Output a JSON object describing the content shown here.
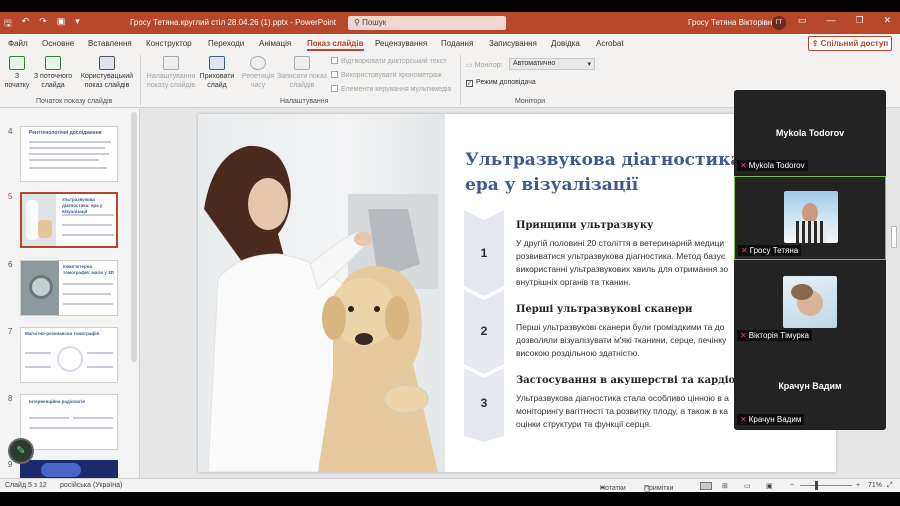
{
  "titlebar": {
    "doc_title": "Гросу Тетяна.круглий стіл 28.04.26 (1).pptx  -  PowerPoint",
    "search_placeholder": "Пошук",
    "user_name": "Гросу Тетяна Вікторівна",
    "user_initials": "ГТ",
    "minimize": "—",
    "restore": "❐",
    "close": "✕"
  },
  "menu": {
    "tabs": [
      "Файл",
      "Основне",
      "Вставлення",
      "Конструктор",
      "Переходи",
      "Анімація",
      "Показ слайдів",
      "Рецензування",
      "Подання",
      "Записування",
      "Довідка",
      "Acrobat"
    ],
    "active_tab": "Показ слайдів",
    "share_label": "Спільний доступ"
  },
  "ribbon": {
    "from_start": "З початку",
    "from_current": "З поточного слайда",
    "custom_show": "Користувацький показ слайдів",
    "group_start": "Початок показу слайдів",
    "setup_show": "Налаштування показу слайдів",
    "hide_slide": "Приховати слайд",
    "rehearse": "Репетиція часу",
    "record": "Записати показ слайдів",
    "chk_narration": "Відтворювати дикторський текст",
    "chk_timings": "Використовувати хронометраж",
    "chk_media": "Елементи керування мультимедіа",
    "group_setup": "Налаштування",
    "monitor_label": "Монітор:",
    "monitor_value": "Автоматично",
    "chk_presenter": "Режим доповідача",
    "group_monitors": "Монітори"
  },
  "thumbnails": [
    {
      "num": "4",
      "title": "Рентгенологічні дослідження"
    },
    {
      "num": "5",
      "title": "Ультразвукова діагностика: ера у візуалізації"
    },
    {
      "num": "6",
      "title": "Комп'ютерна томографія: магія у 3D"
    },
    {
      "num": "7",
      "title": "Магнітно-резонансна томографія"
    },
    {
      "num": "8",
      "title": "Інтервенційна радіологія"
    },
    {
      "num": "9",
      "title": ""
    }
  ],
  "slide": {
    "title": "Ультразвукова діагностика: ера у візуалізації",
    "steps": [
      {
        "num": "1",
        "title": "Принципи ультразвуку",
        "lines": [
          "У другій половині 20 століття в ветеринарній медици",
          "розвиватися ультразвукова діагностика. Метод базує",
          "використанні ультразвукових хвиль для отримання зо",
          "внутрішніх органів та тканин."
        ]
      },
      {
        "num": "2",
        "title": "Перші ультразвукові сканери",
        "lines": [
          "Перші ультразвукові сканери були громіздкими та до",
          "дозволяли візуалізувати м'які тканини, серце, печінку",
          "високою роздільною здатністю."
        ]
      },
      {
        "num": "3",
        "title": "Застосування в акушерстві та кардіології",
        "lines": [
          "Ультразвукова діагностика стала особливо цінною в а",
          "моніторингу вагітності та розвитку плоду, а також в ка",
          "оцінки структури та функції серця."
        ]
      }
    ]
  },
  "statusbar": {
    "slide_info": "Слайд 5 з 12",
    "language": "російська (Україна)",
    "notes": "Нотатки",
    "comments": "Примітки",
    "zoom": "71%"
  },
  "video": {
    "participants": [
      {
        "big_name": "Mykola Todorov",
        "tag": "Mykola Todorov",
        "has_video": false,
        "muted": true
      },
      {
        "big_name": "",
        "tag": "Гросу Тетяна",
        "has_video": true,
        "muted": true,
        "active": true
      },
      {
        "big_name": "",
        "tag": "Вікторія Тімурка",
        "has_video": true,
        "muted": true
      },
      {
        "big_name": "Крачун Вадим",
        "tag": "Крачун Вадим",
        "has_video": false,
        "muted": true
      }
    ]
  },
  "colors": {
    "accent": "#b7472a",
    "slide_title": "#3e5a8f",
    "chevron": "#e6e8ef",
    "speaker_border": "#7fbf3b"
  }
}
